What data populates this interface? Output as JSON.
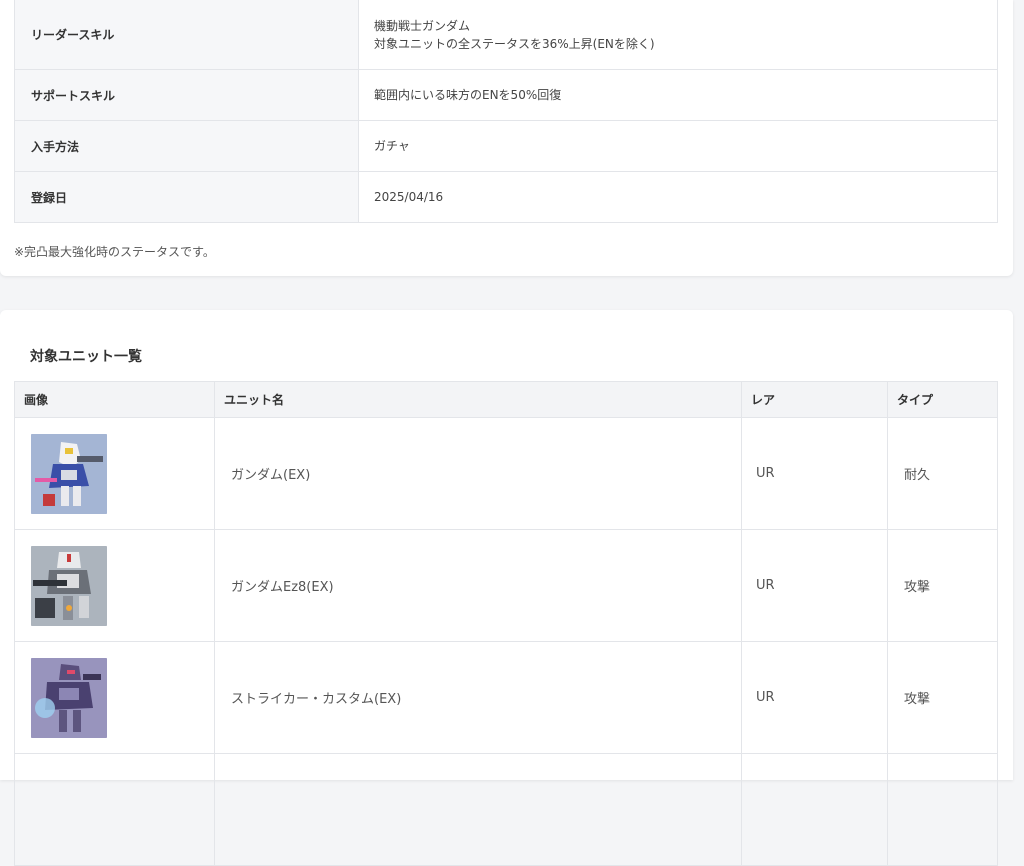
{
  "info_rows": [
    {
      "label": "リーダースキル",
      "value_line1": "機動戦士ガンダム",
      "value_line2": "対象ユニットの全ステータスを36%上昇(ENを除く)"
    },
    {
      "label": "サポートスキル",
      "value": "範囲内にいる味方のENを50%回復"
    },
    {
      "label": "入手方法",
      "value": "ガチャ"
    },
    {
      "label": "登録日",
      "value": "2025/04/16"
    }
  ],
  "note": "※完凸最大強化時のステータスです。",
  "units_section": {
    "title": "対象ユニット一覧",
    "headers": [
      "画像",
      "ユニット名",
      "レア",
      "タイプ"
    ],
    "rows": [
      {
        "name": "ガンダム(EX)",
        "rarity": "UR",
        "type": "耐久",
        "thumb_icon": "gundam-thumbnail"
      },
      {
        "name": "ガンダムEz8(EX)",
        "rarity": "UR",
        "type": "攻撃",
        "thumb_icon": "ez8-thumbnail"
      },
      {
        "name": "ストライカー・カスタム(EX)",
        "rarity": "UR",
        "type": "攻撃",
        "thumb_icon": "striker-thumbnail"
      }
    ]
  },
  "colors": {
    "header_bg": "#f6f7f9",
    "border": "#e3e5e9",
    "page_bg": "#f4f5f7"
  }
}
